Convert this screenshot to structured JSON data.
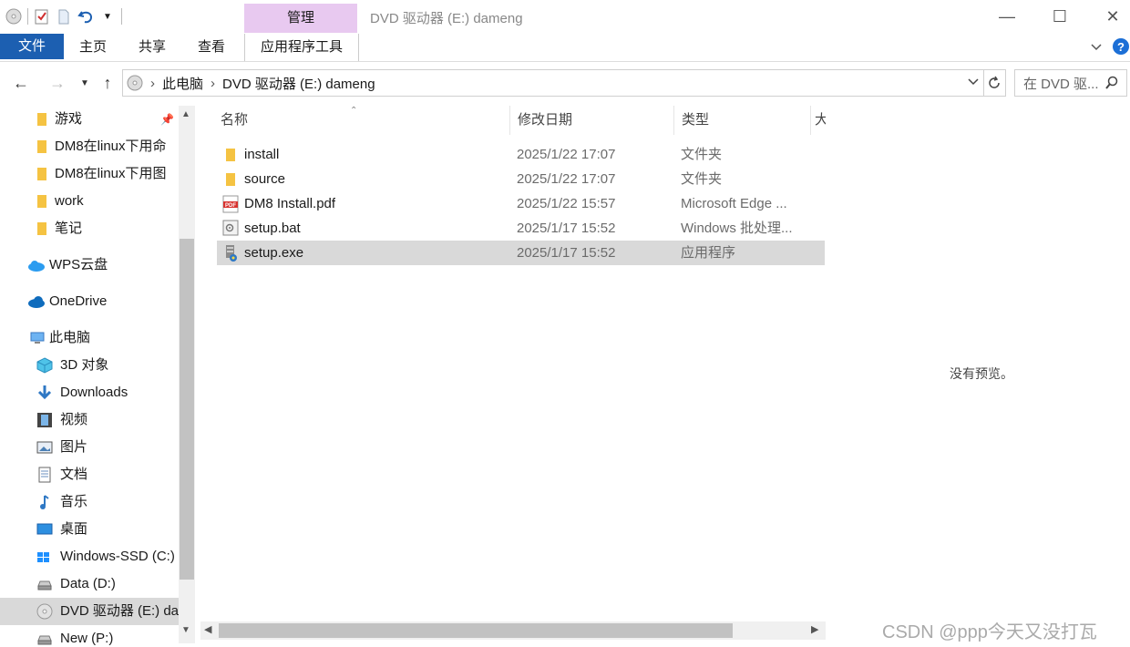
{
  "window": {
    "title": "DVD 驱动器 (E:) dameng",
    "manage_label": "管理",
    "minimize": "—",
    "maximize": "☐",
    "close": "✕"
  },
  "ribbon": {
    "file_tab": "文件",
    "home_tab": "主页",
    "share_tab": "共享",
    "view_tab": "查看",
    "app_tools_tab": "应用程序工具"
  },
  "address": {
    "crumb1": "此电脑",
    "crumb2": "DVD 驱动器 (E:) dameng",
    "search_placeholder": "在 DVD 驱..."
  },
  "nav_pane": [
    {
      "label": "游戏",
      "icon": "folder-icon"
    },
    {
      "label": "DM8在linux下用命",
      "icon": "folder-icon"
    },
    {
      "label": "DM8在linux下用图",
      "icon": "folder-icon"
    },
    {
      "label": "work",
      "icon": "folder-icon"
    },
    {
      "label": "笔记",
      "icon": "folder-icon"
    },
    {
      "label": "WPS云盘",
      "icon": "wps-cloud-icon"
    },
    {
      "label": "OneDrive",
      "icon": "onedrive-icon"
    },
    {
      "label": "此电脑",
      "icon": "computer-icon"
    },
    {
      "label": "3D 对象",
      "icon": "3d-objects-icon"
    },
    {
      "label": "Downloads",
      "icon": "download-icon"
    },
    {
      "label": "视频",
      "icon": "video-icon"
    },
    {
      "label": "图片",
      "icon": "pictures-icon"
    },
    {
      "label": "文档",
      "icon": "documents-icon"
    },
    {
      "label": "音乐",
      "icon": "music-icon"
    },
    {
      "label": "桌面",
      "icon": "desktop-icon"
    },
    {
      "label": "Windows-SSD (C:)",
      "icon": "windows-drive-icon"
    },
    {
      "label": "Data (D:)",
      "icon": "drive-icon"
    },
    {
      "label": "DVD 驱动器 (E:) da",
      "icon": "dvd-icon"
    },
    {
      "label": "New (P:)",
      "icon": "drive-icon"
    }
  ],
  "columns": {
    "name": "名称",
    "modified": "修改日期",
    "type": "类型",
    "size": "大"
  },
  "files": [
    {
      "name": "install",
      "date": "2025/1/22 17:07",
      "type": "文件夹",
      "icon": "folder-icon"
    },
    {
      "name": "source",
      "date": "2025/1/22 17:07",
      "type": "文件夹",
      "icon": "folder-icon"
    },
    {
      "name": "DM8 Install.pdf",
      "date": "2025/1/22 15:57",
      "type": "Microsoft Edge ...",
      "icon": "pdf-icon"
    },
    {
      "name": "setup.bat",
      "date": "2025/1/17 15:52",
      "type": "Windows 批处理...",
      "icon": "batch-file-icon"
    },
    {
      "name": "setup.exe",
      "date": "2025/1/17 15:52",
      "type": "应用程序",
      "icon": "setup-exe-icon"
    }
  ],
  "preview": {
    "text": "没有预览。"
  },
  "watermark": "CSDN @ppp今天又没打瓦",
  "colors": {
    "accent": "#1c5fb1",
    "manage_tab": "#e8c9f0",
    "selection": "#d9d9d9",
    "folder": "#f5c342"
  }
}
